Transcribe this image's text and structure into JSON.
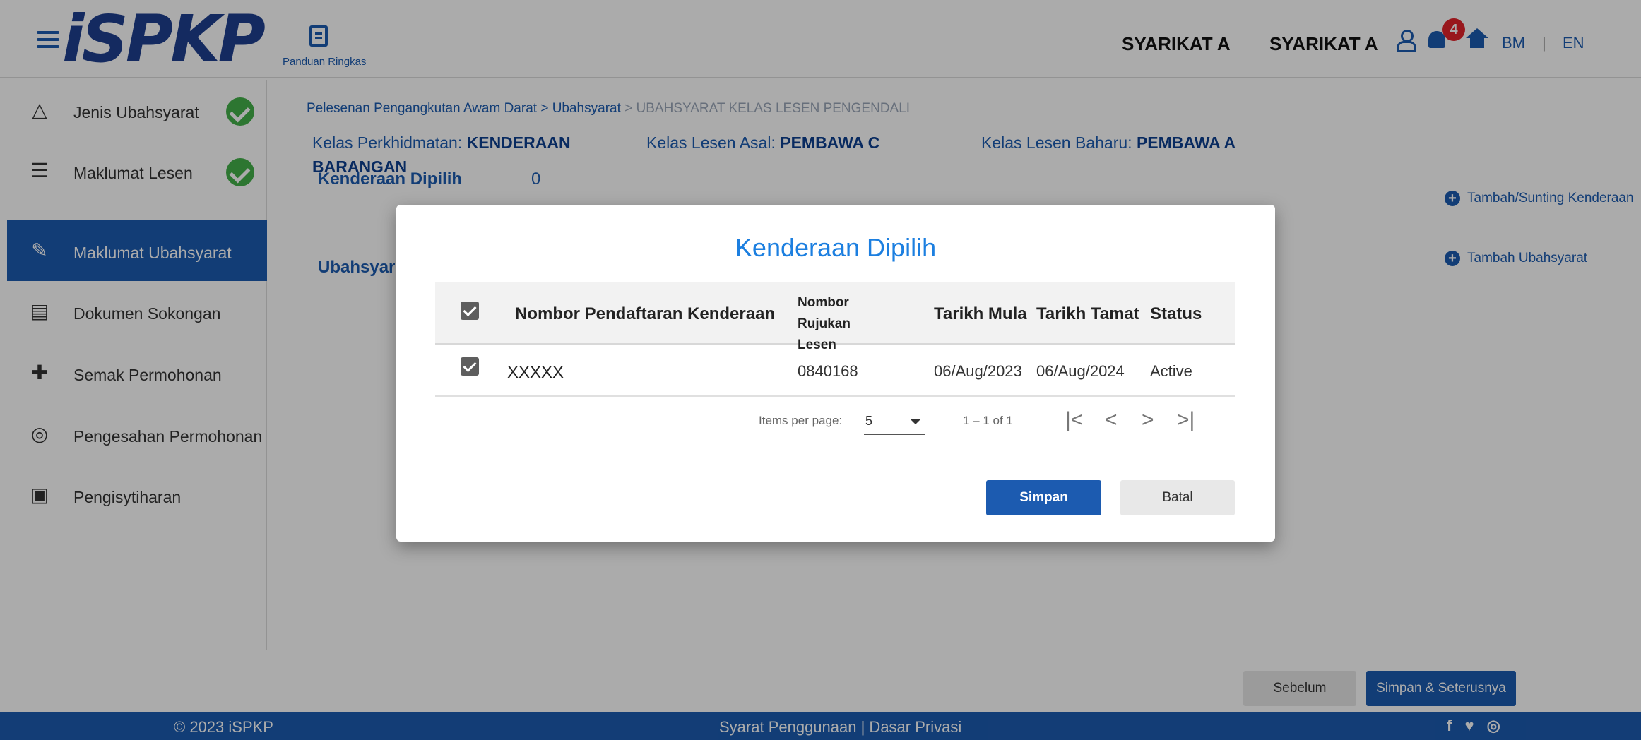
{
  "header": {
    "logo_text": "iSPKP",
    "guide_label": "Panduan Ringkas",
    "company_1": "SYARIKAT A",
    "company_2": "SYARIKAT A",
    "notification_count": "4",
    "lang_bm": "BM",
    "lang_sep": "|",
    "lang_en": "EN"
  },
  "sidebar": {
    "items": [
      {
        "label": "Jenis Ubahsyarat",
        "icon": "triangle-icon",
        "completed": true
      },
      {
        "label": "Maklumat Lesen",
        "icon": "filter-icon",
        "completed": true
      },
      {
        "label": "Maklumat Ubahsyarat",
        "icon": "edit-check-icon",
        "active": true
      },
      {
        "label": "Dokumen Sokongan",
        "icon": "document-icon"
      },
      {
        "label": "Semak Permohonan",
        "icon": "review-icon"
      },
      {
        "label": "Pengesahan Permohonan",
        "icon": "verify-icon"
      },
      {
        "label": "Pengisytiharan",
        "icon": "clipboard-icon"
      }
    ]
  },
  "breadcrumb": {
    "part1": "Pelesenan Pengangkutan Awam Darat",
    "sep1": " > ",
    "part2": "Ubahsyarat",
    "sep2": " > ",
    "current": "UBAHSYARAT KELAS LESEN PENGENDALI"
  },
  "info": {
    "service_label": "Kelas Perkhidmatan: ",
    "service_value": "KENDERAAN",
    "service_value_2": "BARANGAN",
    "old_label": "Kelas Lesen Asal: ",
    "old_value": "PEMBAWA C",
    "new_label": "Kelas Lesen Baharu: ",
    "new_value": "PEMBAWA A"
  },
  "sections": {
    "vehicles_label": "Kenderaan Dipilih",
    "vehicles_count": "0",
    "conditions_label": "Ubahsyarat",
    "add_vehicle": "Tambah/Sunting Kenderaan",
    "add_condition": "Tambah Ubahsyarat"
  },
  "actions": {
    "prev": "Sebelum",
    "next": "Simpan & Seterusnya"
  },
  "footer": {
    "copyright": "© 2023 iSPKP",
    "links": "Syarat Penggunaan | Dasar Privasi",
    "social": "f ♥ ◎"
  },
  "modal": {
    "title": "Kenderaan Dipilih",
    "columns": {
      "reg_no": "Nombor Pendaftaran Kenderaan",
      "ref_no": "Nombor Rujukan Lesen",
      "start": "Tarikh Mula",
      "end": "Tarikh Tamat",
      "status": "Status"
    },
    "rows": [
      {
        "selected": true,
        "reg_no": "XXXXX",
        "ref_no": "0840168",
        "start": "06/Aug/2023",
        "end": "06/Aug/2024",
        "status": "Active"
      }
    ],
    "pager": {
      "items_per_page_label": "Items per page:",
      "items_per_page": "5",
      "range": "1 – 1 of 1"
    },
    "save": "Simpan",
    "cancel": "Batal"
  },
  "colors": {
    "primary": "#1c5bb0",
    "title_blue": "#1c7fe0",
    "success": "#43b04a",
    "badge": "#e3232a"
  }
}
